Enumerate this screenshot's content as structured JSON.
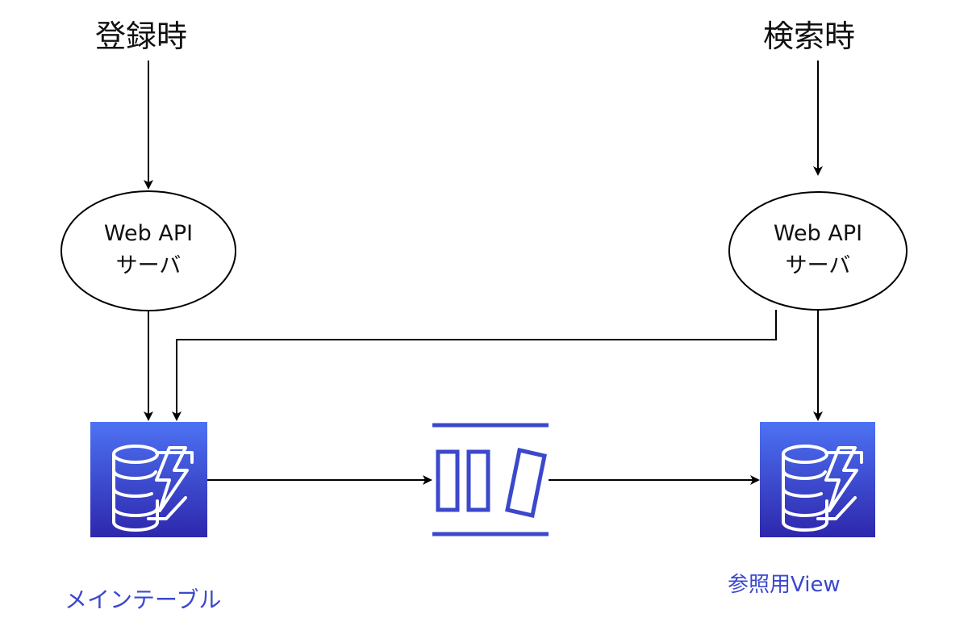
{
  "titles": {
    "register": "登録時",
    "search": "検索時"
  },
  "nodes": {
    "api_left": {
      "line1": "Web API",
      "line2": "サーバ"
    },
    "api_right": {
      "line1": "Web API",
      "line2": "サーバ"
    }
  },
  "captions": {
    "main_table": "メインテーブル",
    "ref_view": "参照用View"
  },
  "icons": {
    "main_table_icon": "dynamodb-icon",
    "stream_icon": "dynamodb-streams-icon",
    "view_icon": "dynamodb-icon"
  },
  "colors": {
    "dynamodb_top": "#4d72f3",
    "dynamodb_bottom": "#2e27ad",
    "stream": "#3b48cc",
    "caption": "#3b48cc",
    "edge": "#000000"
  }
}
